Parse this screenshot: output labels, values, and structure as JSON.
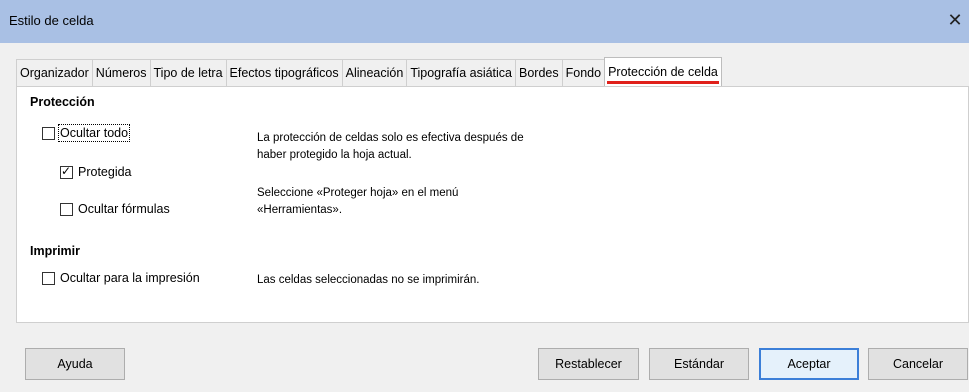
{
  "window": {
    "title": "Estilo de celda"
  },
  "tabs": [
    {
      "label": "Organizador",
      "active": false
    },
    {
      "label": "Números",
      "active": false
    },
    {
      "label": "Tipo de letra",
      "active": false
    },
    {
      "label": "Efectos tipográficos",
      "active": false
    },
    {
      "label": "Alineación",
      "active": false
    },
    {
      "label": "Tipografía asiática",
      "active": false
    },
    {
      "label": "Bordes",
      "active": false
    },
    {
      "label": "Fondo",
      "active": false
    },
    {
      "label": "Protección de celda",
      "active": true
    }
  ],
  "proteccion": {
    "heading": "Protección",
    "ocultar_todo": {
      "label": "Ocultar todo",
      "checked": false
    },
    "protegida": {
      "label": "Protegida",
      "checked": true
    },
    "ocultar_formulas": {
      "label": "Ocultar fórmulas",
      "checked": false
    },
    "info1_line1": "La protección de celdas solo es efectiva después de",
    "info1_line2": "haber protegido la hoja actual.",
    "info2_line1": "Seleccione «Proteger hoja» en el menú",
    "info2_line2": "«Herramientas»."
  },
  "imprimir": {
    "heading": "Imprimir",
    "ocultar_impresion": {
      "label": "Ocultar para la impresión",
      "checked": false
    },
    "info": "Las celdas seleccionadas no se imprimirán."
  },
  "buttons": {
    "ayuda": "Ayuda",
    "restablecer": "Restablecer",
    "estandar": "Estándar",
    "aceptar": "Aceptar",
    "cancelar": "Cancelar"
  }
}
